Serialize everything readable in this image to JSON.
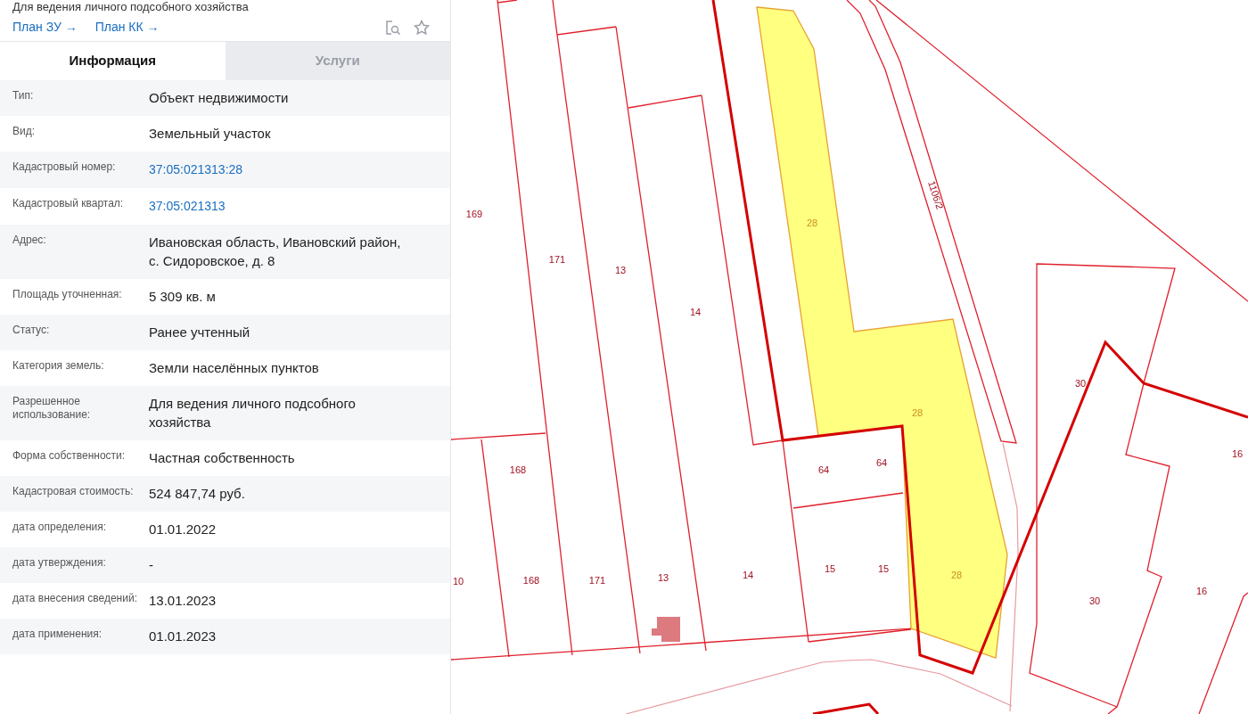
{
  "header": {
    "title": "Для ведения личного подсобного хозяйства",
    "links": [
      "План ЗУ →",
      "План КК →"
    ]
  },
  "tabs": [
    {
      "label": "Информация",
      "selected": true
    },
    {
      "label": "Услуги",
      "selected": false
    }
  ],
  "rows": [
    {
      "label": "Тип:",
      "value": "Объект недвижимости",
      "kind": "text"
    },
    {
      "label": "Вид:",
      "value": "Земельный участок",
      "kind": "text"
    },
    {
      "label": "Кадастровый номер:",
      "value": "37:05:021313:28",
      "kind": "link"
    },
    {
      "label": "Кадастровый квартал:",
      "value": "37:05:021313",
      "kind": "link"
    },
    {
      "label": "Адрес:",
      "value": "Ивановская область, Ивановский район, с. Сидоровское, д. 8",
      "kind": "text"
    },
    {
      "label": "Площадь уточненная:",
      "value": "5 309 кв. м",
      "kind": "text"
    },
    {
      "label": "Статус:",
      "value": "Ранее учтенный",
      "kind": "text"
    },
    {
      "label": "Категория земель:",
      "value": "Земли населённых пунктов",
      "kind": "text"
    },
    {
      "label": "Разрешенное использование:",
      "value": "Для ведения личного подсобного хозяйства",
      "kind": "text"
    },
    {
      "label": "Форма собственности:",
      "value": "Частная собственность",
      "kind": "text"
    },
    {
      "label": "Кадастровая стоимость:",
      "value": "524 847,74 руб.",
      "kind": "text"
    },
    {
      "label": "дата определения:",
      "value": "01.01.2022",
      "kind": "text"
    },
    {
      "label": "дата утверждения:",
      "value": "-",
      "kind": "text"
    },
    {
      "label": "дата внесения сведений:",
      "value": "13.01.2023",
      "kind": "text"
    },
    {
      "label": "дата применения:",
      "value": "01.01.2023",
      "kind": "text"
    }
  ],
  "map": {
    "parcel_labels": [
      {
        "text": "169",
        "selected": false
      },
      {
        "text": "171",
        "selected": false
      },
      {
        "text": "13",
        "selected": false
      },
      {
        "text": "14",
        "selected": false
      },
      {
        "text": "28",
        "selected": true
      },
      {
        "text": "1106/2",
        "selected": false
      },
      {
        "text": "30",
        "selected": false
      },
      {
        "text": "28",
        "selected": true
      },
      {
        "text": "16",
        "selected": false
      },
      {
        "text": "168",
        "selected": false
      },
      {
        "text": "64",
        "selected": false
      },
      {
        "text": "64",
        "selected": false
      },
      {
        "text": "10",
        "selected": false
      },
      {
        "text": "168",
        "selected": false
      },
      {
        "text": "171",
        "selected": false
      },
      {
        "text": "13",
        "selected": false
      },
      {
        "text": "14",
        "selected": false
      },
      {
        "text": "15",
        "selected": false
      },
      {
        "text": "15",
        "selected": false
      },
      {
        "text": "28",
        "selected": true
      },
      {
        "text": "30",
        "selected": false
      },
      {
        "text": "16",
        "selected": false
      }
    ]
  }
}
